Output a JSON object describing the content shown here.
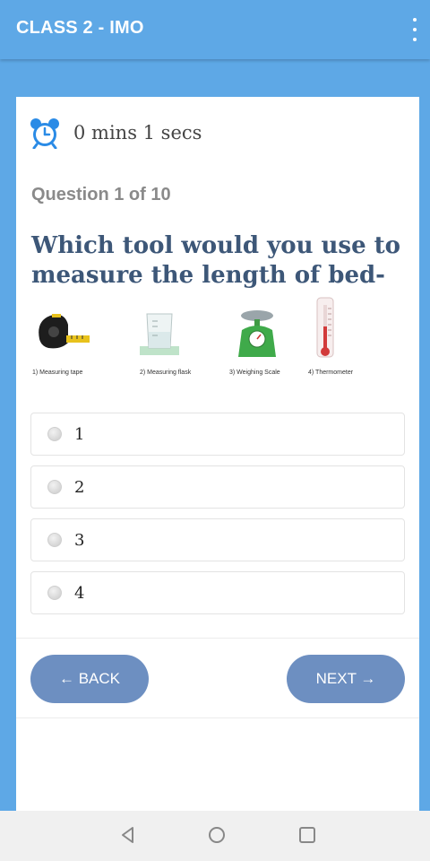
{
  "appbar": {
    "title": "CLASS 2 - IMO",
    "menu_icon": "more-vert-icon"
  },
  "timer": {
    "icon": "alarm-clock-icon",
    "text": "0 mins 1 secs"
  },
  "question": {
    "counter": "Question 1 of 10",
    "text": "Which tool would you use to measure the length of bed-",
    "tools": [
      {
        "label": "1) Measuring tape"
      },
      {
        "label": "2) Measuring flask"
      },
      {
        "label": "3) Weighing Scale"
      },
      {
        "label": "4) Thermometer"
      }
    ]
  },
  "options": [
    {
      "label": "1"
    },
    {
      "label": "2"
    },
    {
      "label": "3"
    },
    {
      "label": "4"
    }
  ],
  "buttons": {
    "back": "← BACK",
    "next": "NEXT →"
  },
  "system_nav": {
    "back": "triangle-back-icon",
    "home": "circle-home-icon",
    "recents": "square-recents-icon"
  },
  "colors": {
    "primary": "#5ea8e6",
    "button": "#6d8fc1",
    "question_text": "#3d5778"
  }
}
